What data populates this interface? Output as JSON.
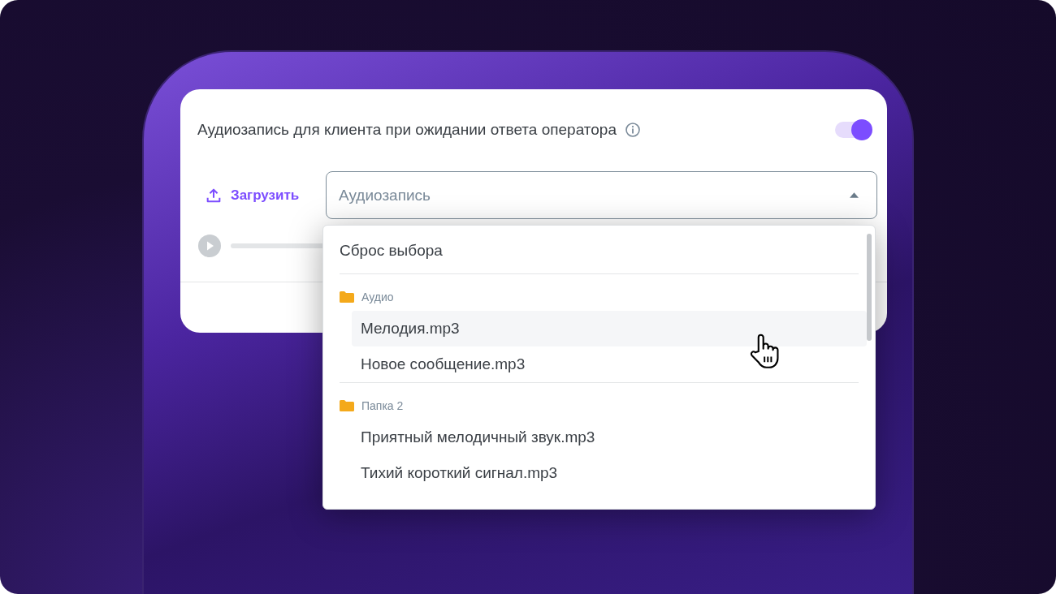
{
  "setting": {
    "label": "Аудиозапись для клиента при ожидании ответа оператора",
    "on": true
  },
  "upload_button": {
    "label": "Загрузить"
  },
  "audio_select": {
    "placeholder": "Аудиозапись",
    "expanded": true
  },
  "dropdown": {
    "reset": "Сброс выбора",
    "groups": [
      {
        "name": "Аудио",
        "items": [
          {
            "label": "Мелодия.mp3",
            "hovered": true
          },
          {
            "label": "Новое сообщение.mp3",
            "hovered": false
          }
        ]
      },
      {
        "name": "Папка 2",
        "items": [
          {
            "label": "Приятный мелодичный звук.mp3",
            "hovered": false
          },
          {
            "label": "Тихий короткий сигнал.mp3",
            "hovered": false
          }
        ]
      }
    ]
  }
}
